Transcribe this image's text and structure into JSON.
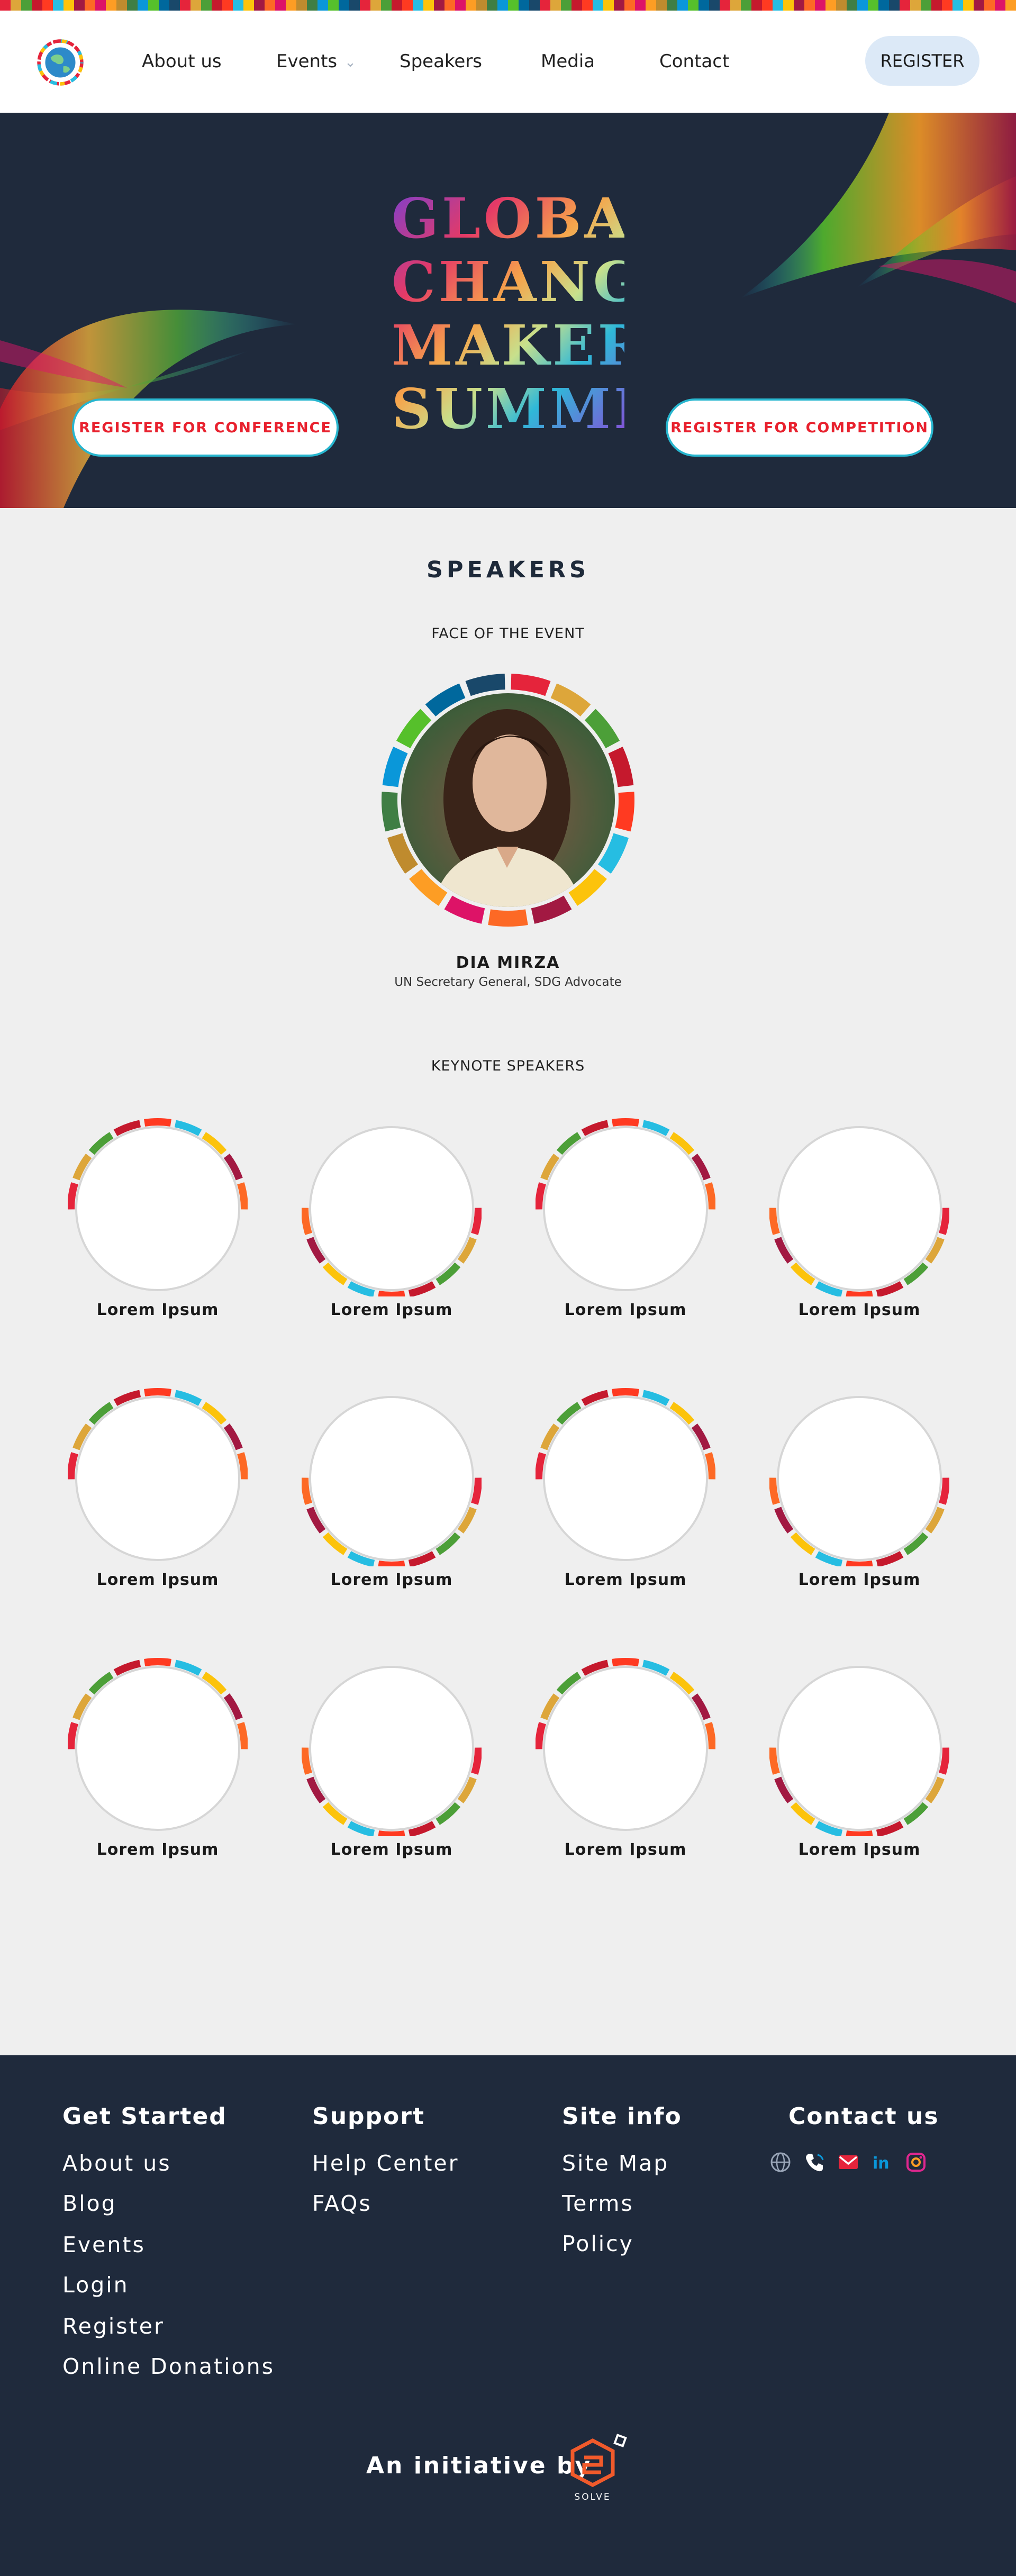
{
  "colors": {
    "sdg": [
      "#e5243b",
      "#dda63a",
      "#4c9f38",
      "#c5192d",
      "#ff3a21",
      "#26bde2",
      "#fcc30b",
      "#a21942",
      "#fd6925",
      "#dd1367",
      "#fd9d24",
      "#bf8b2e",
      "#3f7e44",
      "#0a97d9",
      "#56c02b",
      "#00689d",
      "#19486a"
    ],
    "navy": "#1f2a3c",
    "accent_red": "#e8212e",
    "accent_teal": "#27b6cf",
    "register_bg": "#dce9f7"
  },
  "header": {
    "logo_icon": "globe-logo-icon",
    "nav": [
      {
        "label": "About us"
      },
      {
        "label": "Events"
      },
      {
        "label": "Speakers"
      },
      {
        "label": "Media"
      },
      {
        "label": "Contact"
      }
    ],
    "register_label": "REGISTER"
  },
  "hero": {
    "title_lines": [
      "GLOBAL",
      "CHANGE",
      "MAKERS",
      "SUMMIT"
    ],
    "register_conference": "REGISTER FOR CONFERENCE",
    "register_competition": "REGISTER FOR COMPETITION"
  },
  "speakers": {
    "title": "SPEAKERS",
    "face_heading": "FACE OF THE EVENT",
    "face_name": "DIA MIRZA",
    "face_role": "UN Secretary General, SDG Advocate",
    "keynote_heading": "KEYNOTE SPEAKERS",
    "keynotes": [
      {
        "name": "Lorem Ipsum"
      },
      {
        "name": "Lorem Ipsum"
      },
      {
        "name": "Lorem Ipsum"
      },
      {
        "name": "Lorem Ipsum"
      },
      {
        "name": "Lorem Ipsum"
      },
      {
        "name": "Lorem Ipsum"
      },
      {
        "name": "Lorem Ipsum"
      },
      {
        "name": "Lorem Ipsum"
      },
      {
        "name": "Lorem Ipsum"
      },
      {
        "name": "Lorem Ipsum"
      },
      {
        "name": "Lorem Ipsum"
      },
      {
        "name": "Lorem Ipsum"
      }
    ]
  },
  "footer": {
    "get_started": {
      "heading": "Get Started",
      "links": [
        "About us",
        "Blog",
        "Events",
        "Login",
        "Register",
        "Online Donations"
      ]
    },
    "support": {
      "heading": "Support",
      "links": [
        "Help Center",
        "FAQs"
      ]
    },
    "site_info": {
      "heading": "Site info",
      "links": [
        "Site Map",
        "Terms",
        "Policy"
      ]
    },
    "contact": {
      "heading": "Contact us",
      "icons": [
        "globe-icon",
        "phone-icon",
        "mail-icon",
        "linkedin-icon",
        "instagram-icon"
      ]
    },
    "initiative_text": "An initiative by",
    "solve_logo_text": "SOLVE"
  }
}
